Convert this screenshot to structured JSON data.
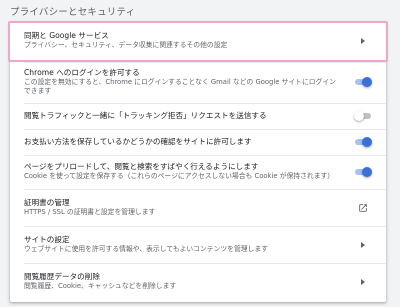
{
  "section_title": "プライバシーとセキュリティ",
  "rows": [
    {
      "title": "同期と Google サービス",
      "sub": "プライバシー、セキュリティ、データ収集に関連するその他の設定",
      "control": "arrow"
    },
    {
      "title": "Chrome へのログインを許可する",
      "sub": "この設定を無効にすると、Chrome にログインすることなく Gmail などの Google サイトにログイン",
      "sub2": "できます",
      "control": "toggle",
      "on": true
    },
    {
      "title": "閲覧トラフィックと一緒に「トラッキング拒否」リクエストを送信する",
      "control": "toggle",
      "on": false
    },
    {
      "title": "お支払い方法を保存しているかどうかの確認をサイトに許可します",
      "control": "toggle",
      "on": true
    },
    {
      "title": "ページをプリロードして、閲覧と検索をすばやく行えるようにします",
      "sub": "Cookie を使って設定を保存する（これらのページにアクセスしない場合も Cookie が保持されます）",
      "control": "toggle",
      "on": true
    },
    {
      "title": "証明書の管理",
      "sub": "HTTPS / SSL の証明書と設定を管理します",
      "control": "external"
    },
    {
      "title": "サイトの設定",
      "sub": "ウェブサイトに使用を許可する情報や、表示してもよいコンテンツを管理します",
      "control": "arrow"
    },
    {
      "title": "閲覧履歴データの削除",
      "sub": "閲覧履歴、Cookie、キャッシュなどを削除します",
      "control": "arrow"
    }
  ],
  "colors": {
    "accent": "#3a6fd8",
    "highlight": "#f0a7c9"
  },
  "icons": {
    "arrow": "arrow-right-icon",
    "external": "open-external-icon"
  }
}
